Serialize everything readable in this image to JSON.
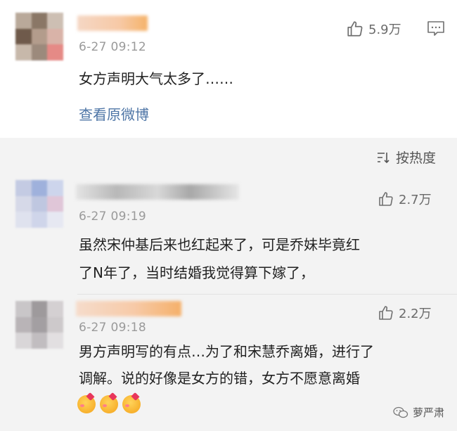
{
  "comments": [
    {
      "timestamp": "6-27 09:12",
      "likes": "5.9万",
      "text": "女方声明大气太多了……",
      "view_original": "查看原微博"
    },
    {
      "timestamp": "6-27 09:19",
      "likes": "2.7万",
      "lines": [
        "虽然宋仲基后来也红起来了，可是乔妹毕竟红",
        "了N年了，当时结婚我觉得算下嫁了，"
      ]
    },
    {
      "timestamp": "6-27 09:18",
      "likes": "2.2万",
      "lines": [
        "男方声明写的有点…为了和宋慧乔离婚，进行了",
        "调解。说的好像是女方的错，女方不愿意离婚"
      ]
    }
  ],
  "sort": {
    "label": "按热度",
    "icon": "sort-icon"
  },
  "watermark": {
    "text": "萝严肃",
    "icon": "wechat-icon"
  },
  "icons": {
    "like": "thumbs-up-icon",
    "comment": "comment-icon",
    "emoji": "kiss-emoji-icon"
  }
}
